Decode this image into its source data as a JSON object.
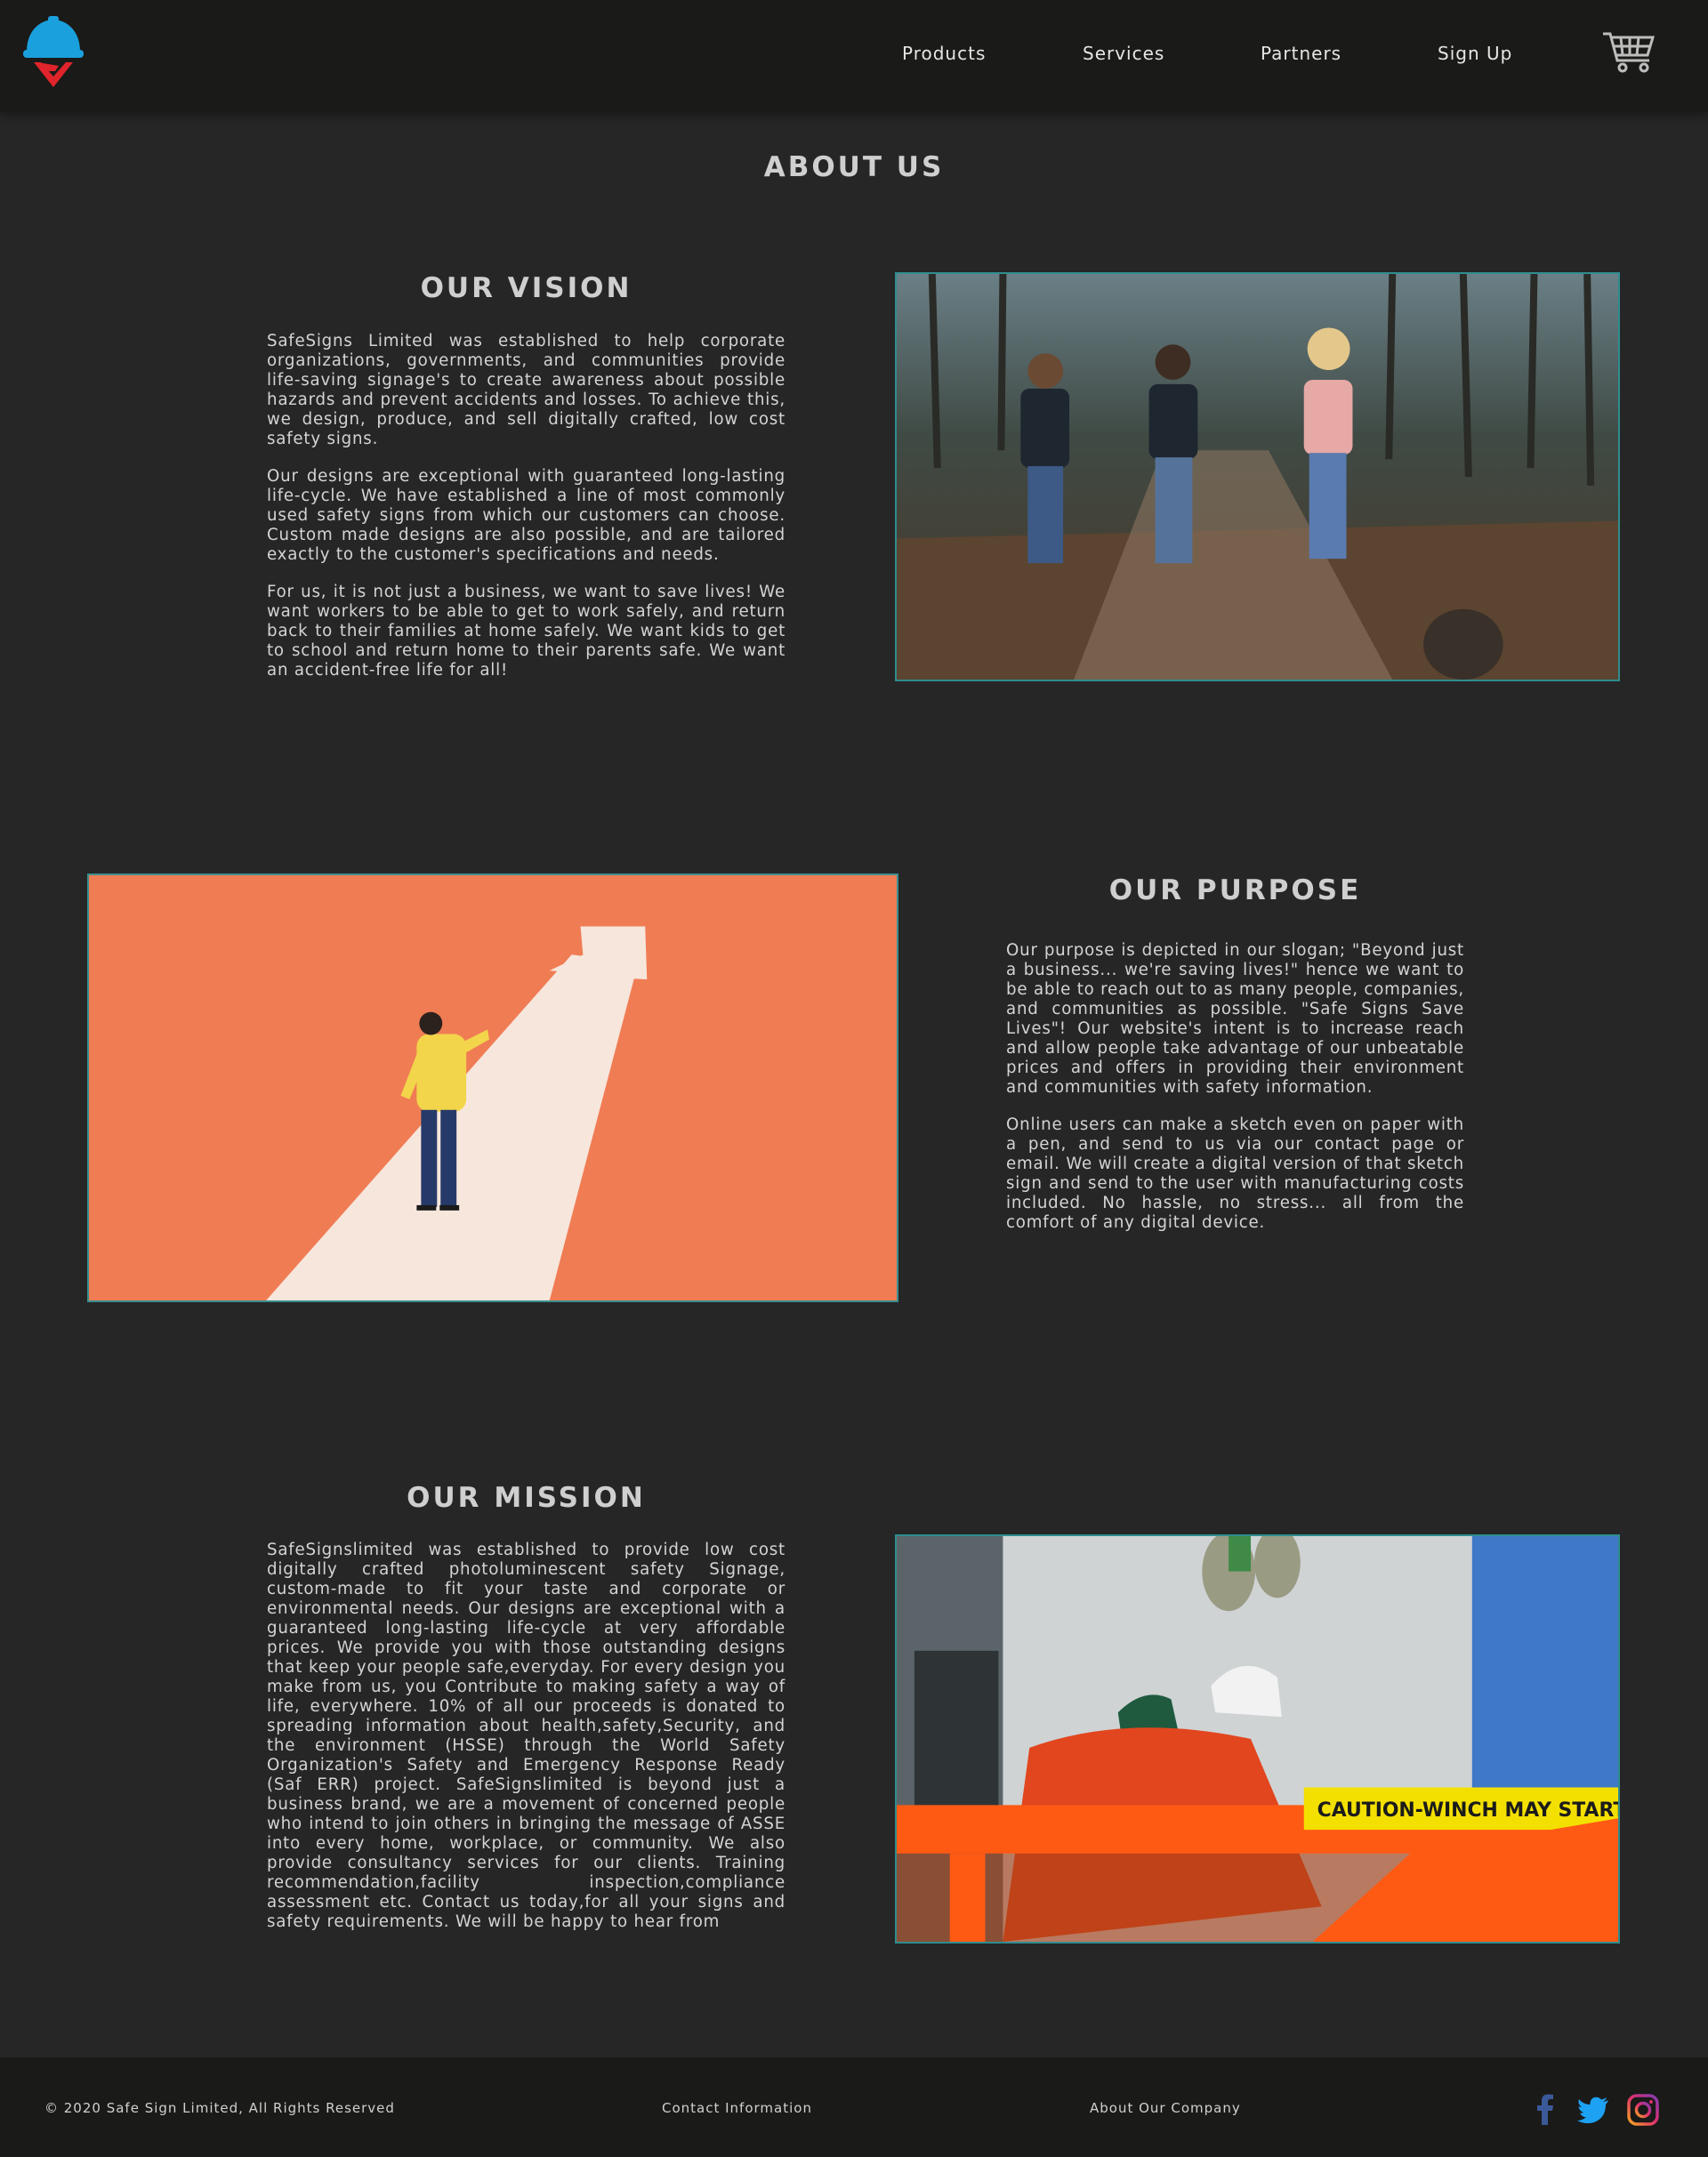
{
  "nav": {
    "links": [
      "Products",
      "Services",
      "Partners",
      "Sign Up"
    ],
    "logo_icon": "helmet-shield-logo-icon",
    "cart_icon": "shopping-cart-icon"
  },
  "page_title": "ABOUT US",
  "vision": {
    "title": "OUR VISION",
    "paragraphs": [
      "SafeSigns Limited was established to help corporate organizations, governments, and communities provide life-saving signage's to create awareness about possible hazards and prevent accidents and losses. To achieve this, we design, produce, and sell digitally crafted, low cost safety signs.",
      "Our designs are exceptional with guaranteed long-lasting life-cycle. We have established a line of most commonly used safety signs from which our customers can choose. Custom made designs are also possible, and are tailored exactly to the customer's specifications and needs.",
      "For us, it is not just a business, we want to save lives! We want workers to be able to get to work safely, and return back to their families at home safely. We want kids to get to school and return home to their parents safe. We want an accident-free life for all!"
    ]
  },
  "purpose": {
    "title": "OUR PURPOSE",
    "paragraphs": [
      "Our purpose is depicted in our slogan; \"Beyond just a business... we're saving lives!\" hence we want to be able to reach out to as many people, companies, and communities as possible. \"Safe Signs Save Lives\"! Our website's intent is to increase reach and allow people take advantage of our unbeatable prices and offers in providing their environment and communities with safety information.",
      "Online users can make a sketch even on paper with a pen, and send to us via our contact page or email. We will create a digital version of that sketch sign and send to the user with manufacturing costs included. No hassle, no stress... all from the comfort of any digital device."
    ]
  },
  "mission": {
    "title": "OUR MISSION",
    "paragraphs": [
      "SafeSignslimited was established to provide low cost digitally crafted photoluminescent safety Signage, custom-made to fit your taste and corporate or environmental needs. Our designs are exceptional with a guaranteed long-lasting life-cycle at very affordable prices. We provide you with those outstanding designs that keep your people safe,everyday. For every design you make from us, you Contribute to making safety a way of life, everywhere. 10% of all our proceeds is donated to spreading information about health,safety,Security, and the environment (HSSE) through the World Safety Organization's Safety and Emergency Response Ready (Saf ERR) project. SafeSignslimited is beyond just a business brand, we are a movement of concerned people who intend to join others in bringing the message of ASSE into every home, workplace, or community. We also provide consultancy services for our clients. Training recommendation,facility inspection,compliance assessment etc. Contact us today,for all your signs and safety requirements. We will be happy to hear from"
    ],
    "banner_text": "CAUTION-WINCH MAY START WITHOUT W"
  },
  "footer": {
    "copyright": "© 2020 Safe Sign Limited, All Rights Reserved",
    "contact": "Contact Information",
    "about": "About Our Company",
    "social_icons": [
      "facebook-icon",
      "twitter-icon",
      "instagram-icon"
    ]
  }
}
